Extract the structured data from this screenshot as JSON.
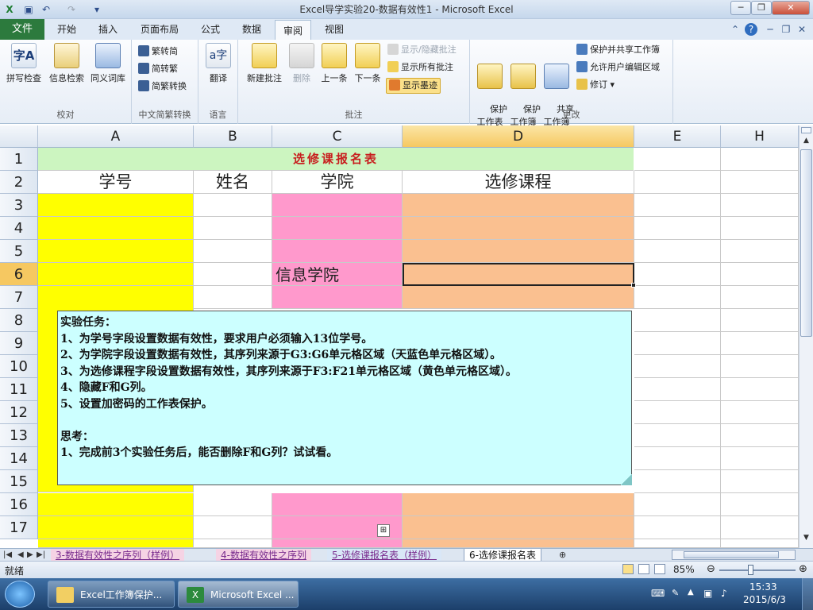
{
  "window": {
    "title": "Excel导学实验20-数据有效性1 - Microsoft Excel",
    "qat": {
      "save_icon": "save-icon",
      "undo_icon": "undo-icon",
      "redo_icon": "redo-icon"
    }
  },
  "tabs": {
    "file": "文件",
    "items": [
      "开始",
      "插入",
      "页面布局",
      "公式",
      "数据",
      "审阅",
      "视图"
    ],
    "active": "审阅"
  },
  "ribbon": {
    "proofing": {
      "label": "校对",
      "spell": "拼写检查",
      "research": "信息检索",
      "thesaurus": "同义词库"
    },
    "chinese": {
      "label": "中文简繁转换",
      "to_simplified": "繁转简",
      "to_traditional": "简转繁",
      "convert": "简繁转换"
    },
    "language": {
      "label": "语言",
      "translate": "翻译"
    },
    "comments": {
      "label": "批注",
      "new": "新建批注",
      "delete": "删除",
      "prev": "上一条",
      "next": "下一条",
      "show_hide": "显示/隐藏批注",
      "show_all": "显示所有批注",
      "show_ink": "显示墨迹"
    },
    "changes": {
      "label": "更改",
      "protect_sheet": "保护\n工作表",
      "protect_wb": "保护\n工作簿",
      "share_wb": "共享\n工作簿",
      "protect_share": "保护并共享工作簿",
      "allow_edit": "允许用户编辑区域",
      "track": "修订"
    }
  },
  "sheet": {
    "columns": [
      "A",
      "B",
      "C",
      "D",
      "E",
      "H"
    ],
    "rows": [
      "1",
      "2",
      "3",
      "4",
      "5",
      "6",
      "7",
      "8",
      "9",
      "10",
      "11",
      "12",
      "13",
      "14",
      "15",
      "16",
      "17"
    ],
    "title": "选修课报名表",
    "headers": [
      "学号",
      "姓名",
      "学院",
      "选修课程"
    ],
    "c6_value": "信息学院",
    "selected_cell": "D6",
    "colors": {
      "yellow": "#ffff00",
      "white": "#ffffff",
      "pink": "#ff99cc",
      "orange": "#fac090",
      "title_bg": "#ccf5c0"
    }
  },
  "note": {
    "text": "实验任务：\n1、为学号字段设置数据有效性，要求用户必须输入13位学号。\n2、为学院字段设置数据有效性，其序列来源于G3:G6单元格区域（天蓝色单元格区域）。\n3、为选修课程字段设置数据有效性，其序列来源于F3:F21单元格区域（黄色单元格区域）。\n4、隐藏F和G列。\n5、设置加密码的工作表保护。\n\n思考：\n1、完成前3个实验任务后，能否删除F和G列？试试看。"
  },
  "sheet_tabs": [
    {
      "label": "3-数据有效性之序列（样例）",
      "active": false
    },
    {
      "label": "4-数据有效性之序列",
      "active": false
    },
    {
      "label": "5-选修课报名表（样例）",
      "active": false
    },
    {
      "label": "6-选修课报名表",
      "active": true
    }
  ],
  "status": {
    "ready": "就绪",
    "zoom": "85%"
  },
  "taskbar": {
    "items": [
      "Excel工作簿保护...",
      "Microsoft Excel ..."
    ],
    "time": "15:33",
    "date": "2015/6/3"
  }
}
